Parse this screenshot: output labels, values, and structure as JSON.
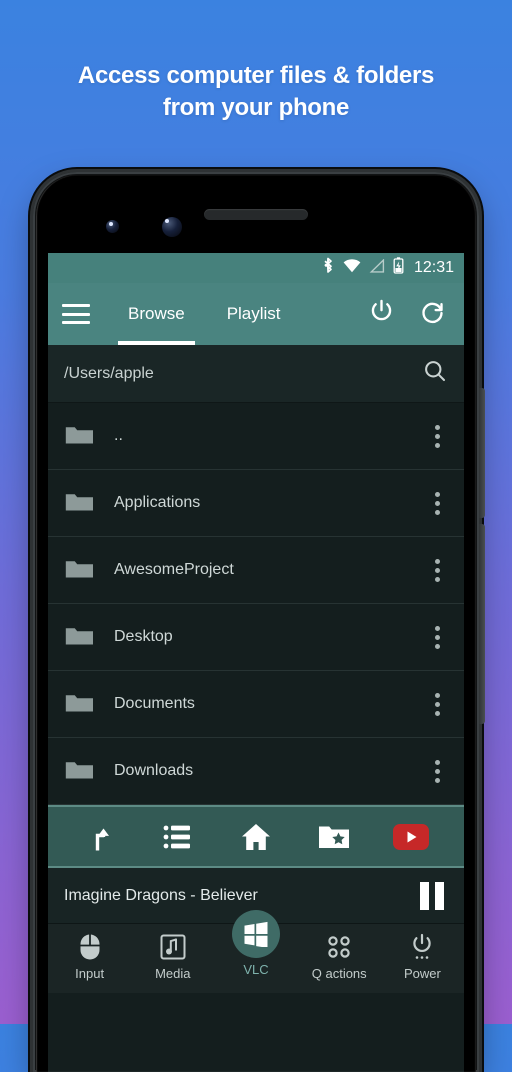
{
  "headline": {
    "line1": "Access computer files & folders",
    "line2": "from your phone"
  },
  "colors": {
    "bg_top": "#3b82e0",
    "bg_bottom": "#9b5fd0",
    "appbar": "#4a8480",
    "statusbar": "#46817c",
    "list_bg": "#141e1e",
    "toolbar": "#335a55",
    "bottomnav": "#1b2525",
    "accent_red": "#c62828",
    "vlc_circle": "#3f6b66"
  },
  "statusbar": {
    "icons": [
      "bluetooth-icon",
      "wifi-icon",
      "signal-icon",
      "battery-charging-icon"
    ],
    "clock": "12:31"
  },
  "appbar": {
    "menu_icon": "hamburger-menu-icon",
    "tabs": [
      {
        "label": "Browse",
        "active": true
      },
      {
        "label": "Playlist",
        "active": false
      }
    ],
    "actions": [
      "power-icon",
      "refresh-icon"
    ]
  },
  "pathbar": {
    "value": "/Users/apple",
    "placeholder": "/Users/apple",
    "search_icon": "search-icon"
  },
  "filelist": {
    "rows": [
      {
        "name": "..",
        "icon": "folder-icon",
        "menu": "overflow-menu-icon"
      },
      {
        "name": "Applications",
        "icon": "folder-icon",
        "menu": "overflow-menu-icon"
      },
      {
        "name": "AwesomeProject",
        "icon": "folder-icon",
        "menu": "overflow-menu-icon"
      },
      {
        "name": "Desktop",
        "icon": "folder-icon",
        "menu": "overflow-menu-icon"
      },
      {
        "name": "Documents",
        "icon": "folder-icon",
        "menu": "overflow-menu-icon"
      },
      {
        "name": "Downloads",
        "icon": "folder-icon",
        "menu": "overflow-menu-icon"
      }
    ]
  },
  "toolbar": {
    "buttons": [
      {
        "name": "parent-directory-icon"
      },
      {
        "name": "list-view-icon"
      },
      {
        "name": "home-icon"
      },
      {
        "name": "favorites-folder-icon"
      },
      {
        "name": "youtube-play-icon"
      }
    ]
  },
  "nowplaying": {
    "title": "Imagine Dragons - Believer",
    "control": "pause-icon"
  },
  "bottomnav": {
    "items": [
      {
        "label": "Input",
        "icon": "mouse-icon",
        "active": false
      },
      {
        "label": "Media",
        "icon": "music-note-icon",
        "active": false
      },
      {
        "label": "VLC",
        "icon": "windows-logo-icon",
        "active": true
      },
      {
        "label": "Q actions",
        "icon": "grid-dots-icon",
        "active": false
      },
      {
        "label": "Power",
        "icon": "power-icon",
        "active": false
      }
    ]
  }
}
